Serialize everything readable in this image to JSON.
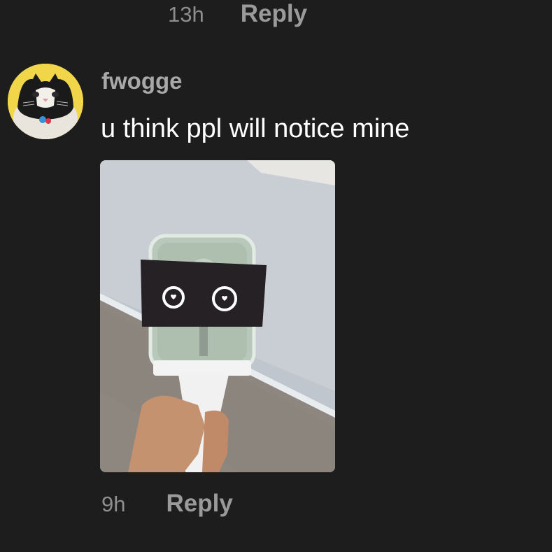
{
  "previous_comment": {
    "time": "13h",
    "reply_label": "Reply"
  },
  "comment": {
    "username": "fwogge",
    "text": "u think ppl will notice mine",
    "time": "9h",
    "reply_label": "Reply",
    "avatar_icon": "cat-avatar",
    "attachment_icon": "lightstick-photo"
  },
  "colors": {
    "background": "#1d1d1d",
    "text_primary": "#ffffff",
    "text_secondary": "#a8a8a8",
    "avatar_bg": "#f2d64a"
  }
}
